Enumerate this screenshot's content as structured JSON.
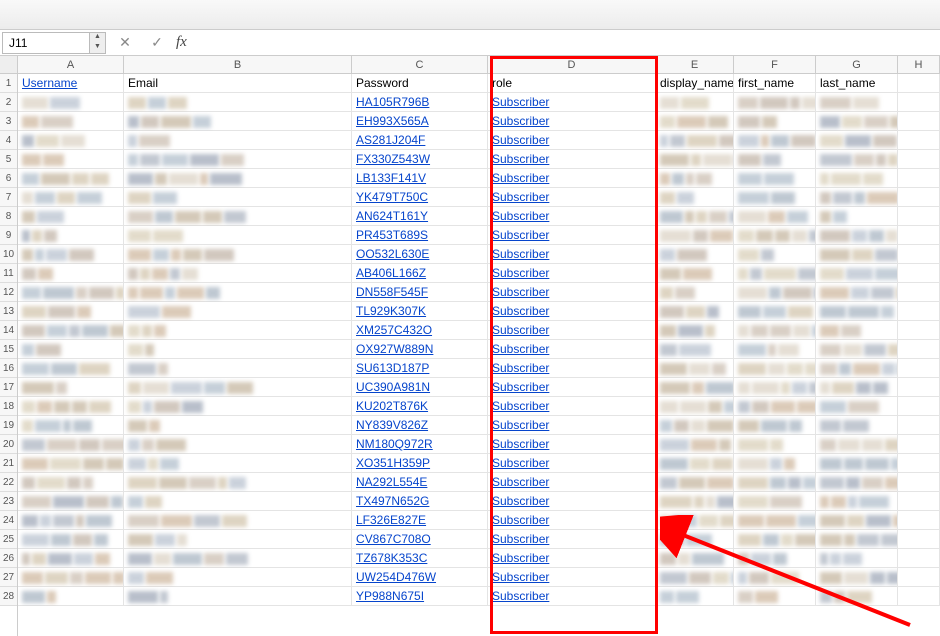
{
  "name_box": "J11",
  "fx_label": "fx",
  "formula_value": "",
  "column_letters": [
    "A",
    "B",
    "C",
    "D",
    "E",
    "F",
    "G",
    "H"
  ],
  "row_numbers": [
    "1",
    "2",
    "3",
    "4",
    "5",
    "6",
    "7",
    "8",
    "9",
    "10",
    "11",
    "12",
    "13",
    "14",
    "15",
    "16",
    "17",
    "18",
    "19",
    "20",
    "21",
    "22",
    "23",
    "24",
    "25",
    "26",
    "27",
    "28"
  ],
  "headers": {
    "A": "Username",
    "B": "Email",
    "C": "Password",
    "D": "role",
    "E": "display_name",
    "F": "first_name",
    "G": "last_name"
  },
  "rows": [
    {
      "password": "HA105R796B",
      "role": "Subscriber"
    },
    {
      "password": "EH993X565A",
      "role": "Subscriber"
    },
    {
      "password": "AS281J204F",
      "role": "Subscriber"
    },
    {
      "password": "FX330Z543W",
      "role": "Subscriber"
    },
    {
      "password": "LB133F141V",
      "role": "Subscriber"
    },
    {
      "password": "YK479T750C",
      "role": "Subscriber"
    },
    {
      "password": "AN624T161Y",
      "role": "Subscriber"
    },
    {
      "password": "PR453T689S",
      "role": "Subscriber"
    },
    {
      "password": "OO532L630E",
      "role": "Subscriber"
    },
    {
      "password": "AB406L166Z",
      "role": "Subscriber"
    },
    {
      "password": "DN558F545F",
      "role": "Subscriber"
    },
    {
      "password": "TL929K307K",
      "role": "Subscriber"
    },
    {
      "password": "XM257C432O",
      "role": "Subscriber"
    },
    {
      "password": "OX927W889N",
      "role": "Subscriber"
    },
    {
      "password": "SU613D187P",
      "role": "Subscriber"
    },
    {
      "password": "UC390A981N",
      "role": "Subscriber"
    },
    {
      "password": "KU202T876K",
      "role": "Subscriber"
    },
    {
      "password": "NY839V826Z",
      "role": "Subscriber"
    },
    {
      "password": "NM180Q972R",
      "role": "Subscriber"
    },
    {
      "password": "XO351H359P",
      "role": "Subscriber"
    },
    {
      "password": "NA292L554E",
      "role": "Subscriber"
    },
    {
      "password": "TX497N652G",
      "role": "Subscriber"
    },
    {
      "password": "LF326E827E",
      "role": "Subscriber"
    },
    {
      "password": "CV867C708O",
      "role": "Subscriber"
    },
    {
      "password": "TZ678K353C",
      "role": "Subscriber"
    },
    {
      "password": "UW254D476W",
      "role": "Subscriber"
    },
    {
      "password": "YP988N675I",
      "role": "Subscriber"
    }
  ],
  "blur_palette": [
    "#c8b89a",
    "#8a95a8",
    "#b8a68a",
    "#d4c9b8",
    "#9aa4b3",
    "#c4a88a",
    "#a8b4c4",
    "#d0c4a8",
    "#b4a494",
    "#94a4b4",
    "#c0b0a0",
    "#a0b0c0"
  ]
}
